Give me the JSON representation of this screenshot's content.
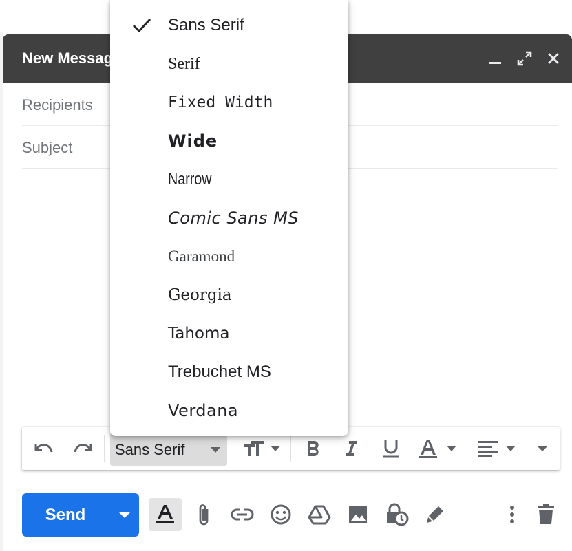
{
  "compose": {
    "title": "New Message",
    "recipients_placeholder": "Recipients",
    "subject_placeholder": "Subject"
  },
  "font_menu": {
    "selected": "Sans Serif",
    "items": [
      {
        "label": "Sans Serif",
        "checked": true
      },
      {
        "label": "Serif"
      },
      {
        "label": "Fixed Width"
      },
      {
        "label": "Wide"
      },
      {
        "label": "Narrow"
      },
      {
        "label": "Comic Sans MS"
      },
      {
        "label": "Garamond"
      },
      {
        "label": "Georgia"
      },
      {
        "label": "Tahoma"
      },
      {
        "label": "Trebuchet MS"
      },
      {
        "label": "Verdana"
      }
    ]
  },
  "toolbar": {
    "font_value": "Sans Serif"
  },
  "actions": {
    "send_label": "Send"
  },
  "colors": {
    "header_bg": "#404040",
    "send_blue": "#1a73e8",
    "icon_gray": "#5f6368"
  }
}
